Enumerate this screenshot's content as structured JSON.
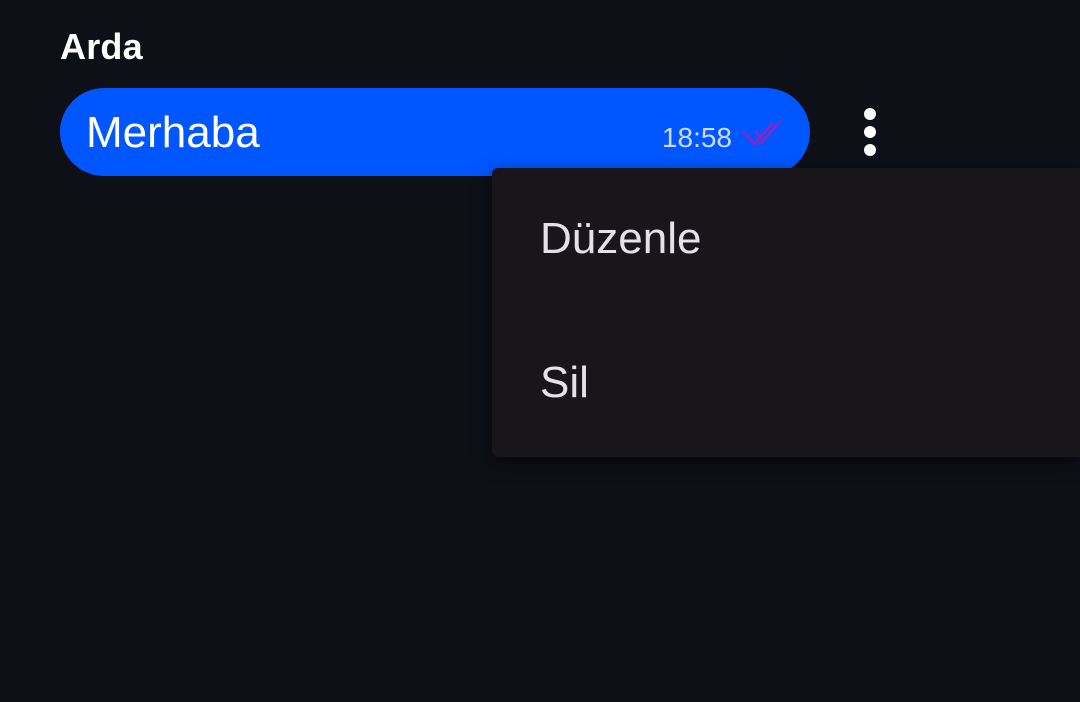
{
  "chat": {
    "sender_name": "Arda",
    "message": {
      "text": "Merhaba",
      "time": "18:58",
      "status_icon": "double-check-icon",
      "bubble_color": "#0057ff",
      "check_color": "#7a2bd1"
    },
    "more_icon": "more-vertical-icon"
  },
  "context_menu": {
    "items": [
      {
        "label": "Düzenle"
      },
      {
        "label": "Sil"
      }
    ]
  },
  "colors": {
    "background": "#0d1017",
    "menu_background": "#18151b",
    "menu_text": "#e6e1e8"
  }
}
